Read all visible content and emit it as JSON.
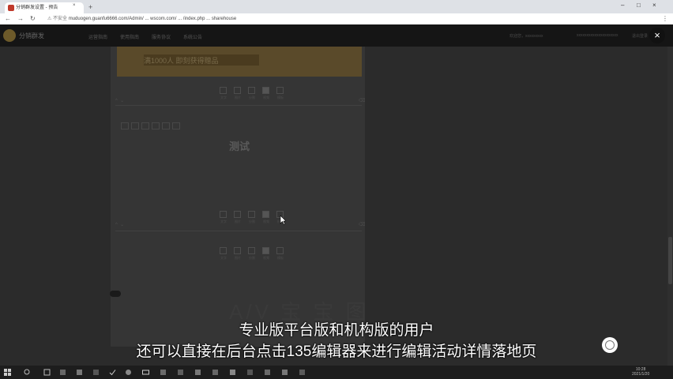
{
  "browser": {
    "tab_title": "分销群发设置 - 预告",
    "tab_close": "×",
    "new_tab": "+",
    "url_secure": "⚠ 不安全",
    "url": "muduogen.guanfu6666.com/Admin/ ... wscom.com/ ... /index.php ... sharehouse",
    "window_controls": [
      "–",
      "□",
      "×"
    ]
  },
  "site": {
    "logo_text": "分销群发",
    "nav": [
      "运营指南",
      "使用指南",
      "服务协议",
      "系统公告"
    ],
    "header_right": [
      "欢迎您，xxxxxxxxx",
      "xxxxxxxxxxxxxxxxxxxxx",
      "退出登录"
    ]
  },
  "banner": {
    "text": "满1000人  即刻获得赠品"
  },
  "editor": {
    "test_title": "测试",
    "tools": [
      "文字",
      "图片",
      "分割",
      "视频",
      "模板"
    ]
  },
  "subtitles": {
    "line1": "专业版平台版和机构版的用户",
    "line2": "还可以直接在后台点击135编辑器来进行编辑活动详情落地页"
  },
  "watermark": "A/V  宝  宝  图",
  "close_icon": "×",
  "taskbar": {
    "time": "10:28",
    "date": "2021/1/20"
  },
  "colors": {
    "overlay": "#2b2b2b",
    "header": "#151515",
    "subtitle": "#ffffff"
  }
}
